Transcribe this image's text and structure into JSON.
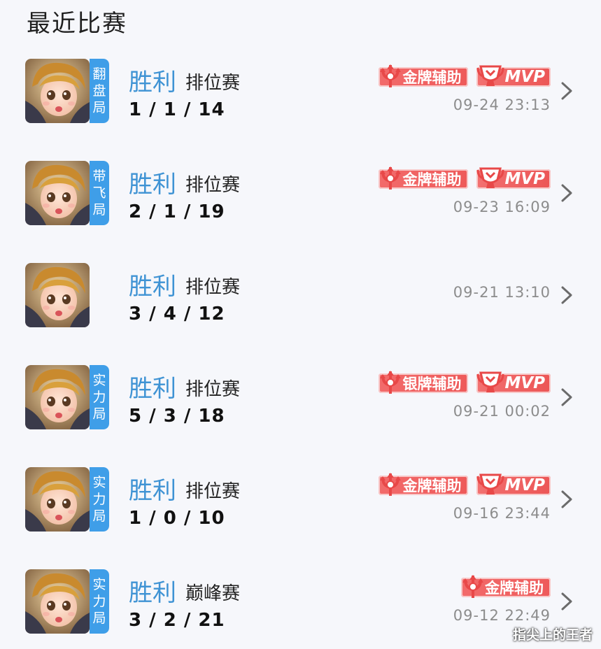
{
  "section_title": "最近比赛",
  "colors": {
    "accent_blue": "#3f93d4",
    "tag_blue": "#3f9ee8",
    "badge_red": "#ee5a5a",
    "time_gray": "#8c8c8c"
  },
  "matches": [
    {
      "tag": [
        "翻",
        "盘",
        "局"
      ],
      "result": "胜利",
      "mode": "排位赛",
      "kda": "1 / 1 / 14",
      "badges": [
        {
          "type": "medal",
          "label": "金牌辅助",
          "icon": "trident-icon"
        },
        {
          "type": "mvp",
          "label": "MVP",
          "icon": "trophy-icon"
        }
      ],
      "time": "09-24  23:13"
    },
    {
      "tag": [
        "带",
        "飞",
        "局"
      ],
      "result": "胜利",
      "mode": "排位赛",
      "kda": "2 / 1 / 19",
      "badges": [
        {
          "type": "medal",
          "label": "金牌辅助",
          "icon": "trident-icon"
        },
        {
          "type": "mvp",
          "label": "MVP",
          "icon": "trophy-icon"
        }
      ],
      "time": "09-23  16:09"
    },
    {
      "tag": [],
      "result": "胜利",
      "mode": "排位赛",
      "kda": "3 / 4 / 12",
      "badges": [],
      "time": "09-21  13:10"
    },
    {
      "tag": [
        "实",
        "力",
        "局"
      ],
      "result": "胜利",
      "mode": "排位赛",
      "kda": "5 / 3 / 18",
      "badges": [
        {
          "type": "medal",
          "label": "银牌辅助",
          "icon": "trident-icon"
        },
        {
          "type": "mvp",
          "label": "MVP",
          "icon": "trophy-icon"
        }
      ],
      "time": "09-21  00:02"
    },
    {
      "tag": [
        "实",
        "力",
        "局"
      ],
      "result": "胜利",
      "mode": "排位赛",
      "kda": "1 / 0 / 10",
      "badges": [
        {
          "type": "medal",
          "label": "金牌辅助",
          "icon": "trident-icon"
        },
        {
          "type": "mvp",
          "label": "MVP",
          "icon": "trophy-icon"
        }
      ],
      "time": "09-16  23:44"
    },
    {
      "tag": [
        "实",
        "力",
        "局"
      ],
      "result": "胜利",
      "mode": "巅峰赛",
      "kda": "3 / 2 / 21",
      "badges": [
        {
          "type": "medal",
          "label": "金牌辅助",
          "icon": "trident-icon"
        }
      ],
      "time": "09-12  22:49"
    }
  ],
  "watermark": "指尖上的王者"
}
